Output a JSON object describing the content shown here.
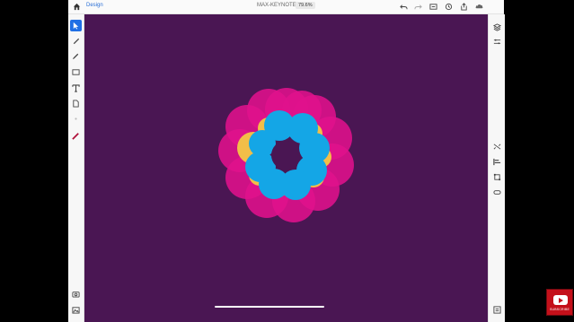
{
  "app": {
    "mode_label": "Design",
    "document_title": "MAX-KEYNOTE",
    "zoom": "79.6%"
  },
  "colors": {
    "canvas_bg": "#4a1653",
    "petal_pink": "#e0118c",
    "petal_yellow": "#f2be48",
    "petal_cyan": "#14a6e6",
    "accent": "#1f6fe5"
  },
  "topbar_icons": [
    "home-icon",
    "undo-icon",
    "redo-icon",
    "share-icon",
    "preview-icon",
    "export-icon",
    "cloud-icon"
  ],
  "left_tools": [
    "select-icon",
    "pen-icon",
    "pencil-icon",
    "rectangle-icon",
    "text-icon",
    "image-icon",
    "color-icon",
    "camera-icon",
    "photo-icon"
  ],
  "right_tools": [
    "layers-icon",
    "properties-icon",
    "repeat-icon",
    "align-icon",
    "crop-icon",
    "boolean-icon",
    "settings-icon"
  ],
  "watermark": {
    "label": "SUBSCRIBE"
  }
}
